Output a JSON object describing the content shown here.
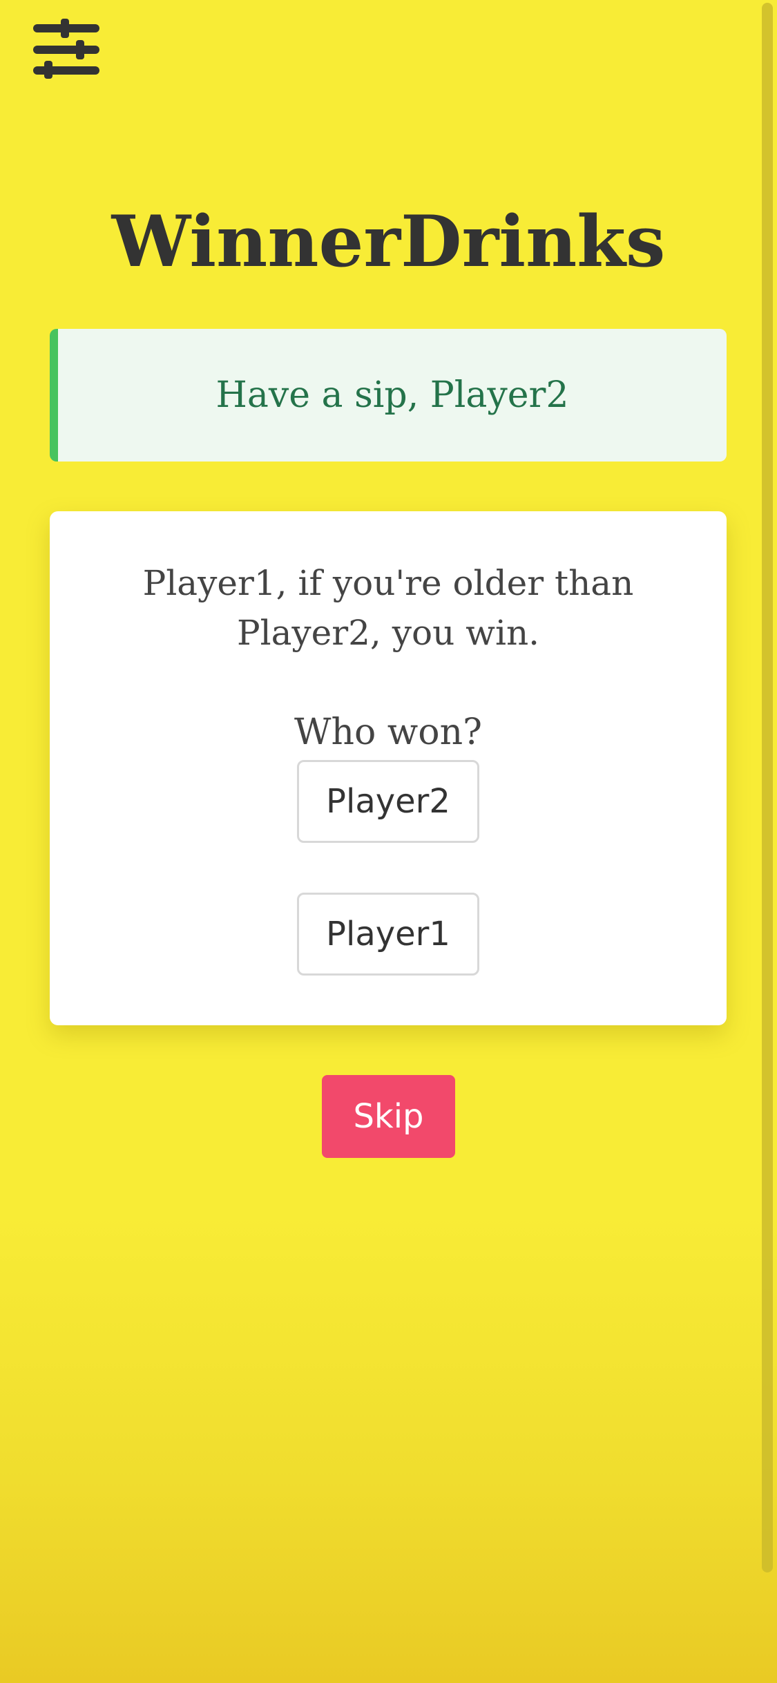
{
  "header": {
    "settings_icon": "sliders-icon"
  },
  "app": {
    "title": "WinnerDrinks"
  },
  "notice": {
    "text": "Have a sip, Player2",
    "accent_color": "#47c35e"
  },
  "challenge": {
    "text": "Player1, if you're older than Player2, you win.",
    "question": "Who won?",
    "options": [
      {
        "label": "Player2"
      },
      {
        "label": "Player1"
      }
    ]
  },
  "actions": {
    "skip_label": "Skip",
    "skip_color": "#f2496b"
  },
  "theme": {
    "background": "#f8ec36",
    "text": "#333333"
  }
}
